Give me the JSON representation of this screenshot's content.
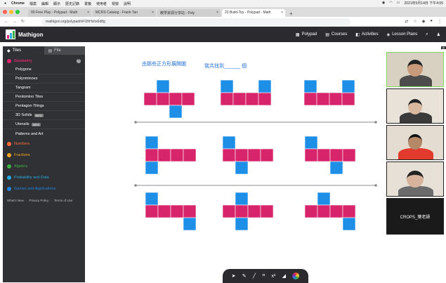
{
  "menubar": {
    "apple": "",
    "app": "Chrome",
    "items": [
      "檔案",
      "編輯",
      "顯示",
      "歷史記錄",
      "書籤",
      "使用者",
      "視窗",
      "說明"
    ],
    "right": "2021年5月14日 下午4:05"
  },
  "tabs": [
    {
      "title": "00 Free Play - Polypad - Math",
      "active": false
    },
    {
      "title": "MCRS Catalog - Frank Tan",
      "active": false
    },
    {
      "title": "教學資源分享站 - Poly",
      "active": false
    },
    {
      "title": "23 Build-Toy - Polypad - Math",
      "active": true
    }
  ],
  "address": {
    "url": "mathigon.org/polypad/nFOfrHxhx6d8g"
  },
  "app": {
    "title": "Mathigon",
    "nav": [
      {
        "label": "Polypad",
        "icon": "polypad-icon"
      },
      {
        "label": "Courses",
        "icon": "courses-icon"
      },
      {
        "label": "Activities",
        "icon": "activities-icon"
      },
      {
        "label": "Lesson Plans",
        "icon": "lesson-plans-icon"
      }
    ]
  },
  "sidebar": {
    "tabs": [
      {
        "label": "Tiles",
        "icon": "shapes-icon"
      },
      {
        "label": "File",
        "icon": "file-icon"
      }
    ],
    "categories": [
      {
        "label": "Geometry",
        "color": "#e3266f",
        "expanded": true
      },
      {
        "label": "Numbers",
        "color": "#ff6b35"
      },
      {
        "label": "Fractions",
        "color": "#f6a821"
      },
      {
        "label": "Algebra",
        "color": "#3fb045"
      },
      {
        "label": "Probability and Data",
        "color": "#28a9e0"
      },
      {
        "label": "Games and Applications",
        "color": "#1f84e0"
      }
    ],
    "geometry_items": [
      {
        "label": "Polygons"
      },
      {
        "label": "Polyominoes"
      },
      {
        "label": "Tangram"
      },
      {
        "label": "Pentomino Tiles"
      },
      {
        "label": "Pentagon Tilings"
      },
      {
        "label": "3D Solids",
        "badge": "NEW"
      },
      {
        "label": "Utensils",
        "badge": "NEW"
      },
      {
        "label": "Patterns and Art"
      }
    ],
    "footer": [
      "What's New",
      "·",
      "Privacy Policy",
      "·",
      "Terms of Use"
    ]
  },
  "canvas": {
    "title": "由那些正方形展開圖",
    "subtitle": "我共找到______ 個",
    "colors": {
      "pink": "#d8246a",
      "blue": "#1e8fe6",
      "line": "#888888"
    }
  },
  "participants": [
    {
      "name": ""
    },
    {
      "name": ""
    },
    {
      "name": ""
    },
    {
      "name": ""
    },
    {
      "name": "CROPS_葉老師"
    }
  ],
  "toolbar": {
    "tools": [
      "cursor-icon",
      "pen-icon",
      "line-icon",
      "crop-icon",
      "superscript-icon",
      "eraser-icon",
      "color-picker-icon"
    ],
    "x2": "x²"
  }
}
